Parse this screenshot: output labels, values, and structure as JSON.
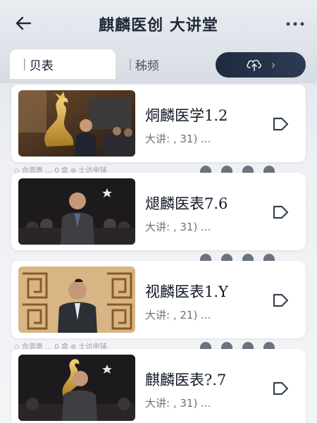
{
  "header": {
    "title": "麒麟医创 大讲堂",
    "back_icon": "back-arrow-icon",
    "more_icon": "more-dots-icon"
  },
  "tabs": [
    {
      "label": "贝表",
      "active": true
    },
    {
      "label": "秭频",
      "active": false
    }
  ],
  "action": {
    "icon": "cloud-upload-icon",
    "chevron": "›"
  },
  "cards": [
    {
      "title": "烔麟医学1.2",
      "subtitle": "大讲: , 31) ...",
      "meta": "◇ 合周惠 … 0 盒         ⊕ 士访申铺"
    },
    {
      "title": "煺麟医表7.6",
      "subtitle": "大讲: , 31) ...",
      "meta": ""
    },
    {
      "title": "视麟医表1.Y",
      "subtitle": "大讲: , 21) ...",
      "meta": "◇ 合周惠 … 0 盒         ⊕ 士访申铺"
    },
    {
      "title": "麒麟医表?.7",
      "subtitle": "大讲: , 31) ...",
      "meta": ""
    }
  ],
  "colors": {
    "accent_dark": "#1e2a3d",
    "text_primary": "#111827",
    "text_secondary": "#6b7280"
  }
}
